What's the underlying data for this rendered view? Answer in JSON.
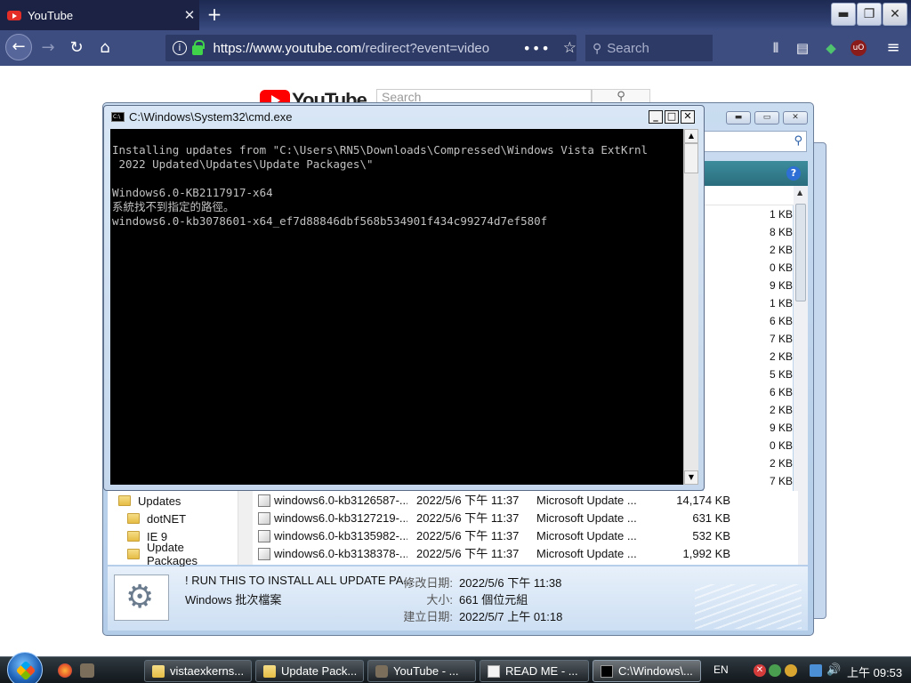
{
  "firefox": {
    "tab_title": "YouTube",
    "tab_close": "✕",
    "new_tab": "+",
    "url_host": "https://www.youtube.com",
    "url_path": "/redirect?event=video",
    "url_menu": "•••",
    "search_placeholder": "Search",
    "window_controls": {
      "minimize": "▬",
      "maximize": "❐",
      "close": "✕"
    }
  },
  "youtube": {
    "logo_text": "YouTube",
    "search_placeholder": "Search"
  },
  "cmd": {
    "title": "C:\\Windows\\System32\\cmd.exe",
    "lines": [
      "Installing updates from \"C:\\Users\\RN5\\Downloads\\Compressed\\Windows Vista ExtKrnl",
      " 2022 Updated\\Updates\\Update Packages\\\"",
      "",
      "Windows6.0-KB2117917-x64",
      "系統找不到指定的路徑。",
      "windows6.0-kb3078601-x64_ef7d88846dbf568b534901f434c99274d7ef580f"
    ],
    "controls": {
      "minimize": "_",
      "maximize": "□",
      "close": "✕"
    }
  },
  "explorer": {
    "size_column": [
      "1 KB",
      "8 KB",
      "2 KB",
      "0 KB",
      "9 KB",
      "1 KB",
      "6 KB",
      "7 KB",
      "2 KB",
      "5 KB",
      "6 KB",
      "2 KB",
      "9 KB",
      "0 KB",
      "2 KB",
      "7 KB"
    ],
    "tree": [
      {
        "label": "Updates"
      },
      {
        "label": "dotNET"
      },
      {
        "label": "IE 9"
      },
      {
        "label": "Update Packages"
      }
    ],
    "files": [
      {
        "name": "windows6.0-kb3126587-...",
        "date": "2022/5/6 下午 11:37",
        "type": "Microsoft Update ...",
        "size": "14,174 KB"
      },
      {
        "name": "windows6.0-kb3127219-...",
        "date": "2022/5/6 下午 11:37",
        "type": "Microsoft Update ...",
        "size": "631 KB"
      },
      {
        "name": "windows6.0-kb3135982-...",
        "date": "2022/5/6 下午 11:37",
        "type": "Microsoft Update ...",
        "size": "532 KB"
      },
      {
        "name": "windows6.0-kb3138378-...",
        "date": "2022/5/6 下午 11:37",
        "type": "Microsoft Update ...",
        "size": "1,992 KB"
      }
    ],
    "details": {
      "filename": "! RUN THIS TO INSTALL ALL UPDATE PA...",
      "filetype": "Windows 批次檔案",
      "modified_label": "修改日期:",
      "modified_value": "2022/5/6 下午 11:38",
      "size_label": "大小:",
      "size_value": "661 個位元組",
      "created_label": "建立日期:",
      "created_value": "2022/5/7 上午 01:18"
    }
  },
  "taskbar": {
    "buttons": [
      {
        "label": "vistaexkerns...",
        "icon": "folder-icon"
      },
      {
        "label": "Update Pack...",
        "icon": "folder-icon"
      },
      {
        "label": "YouTube - ...",
        "icon": "gimp-icon"
      },
      {
        "label": "READ ME - ...",
        "icon": "document-icon"
      },
      {
        "label": "C:\\Windows\\...",
        "icon": "cmd-icon"
      }
    ],
    "language": "EN",
    "clock": "上午 09:53"
  }
}
